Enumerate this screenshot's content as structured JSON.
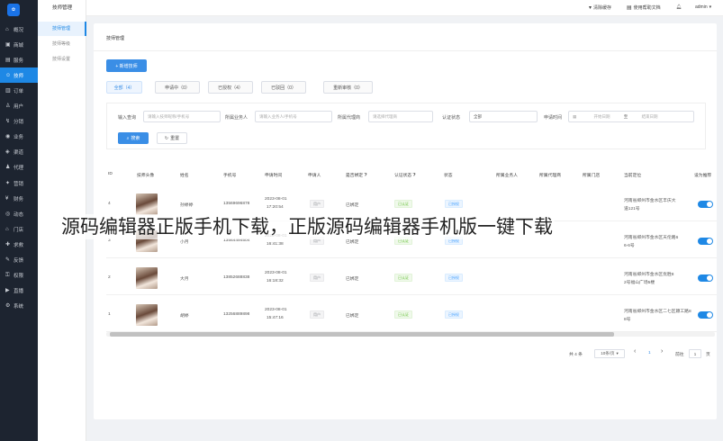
{
  "nav": {
    "logo": "logo",
    "items": [
      {
        "label": "概况",
        "icon": "home-icon"
      },
      {
        "label": "商城",
        "icon": "shop-icon"
      },
      {
        "label": "服务",
        "icon": "service-icon"
      },
      {
        "label": "技师",
        "icon": "technician-icon"
      },
      {
        "label": "订单",
        "icon": "order-icon"
      },
      {
        "label": "用户",
        "icon": "user-icon"
      },
      {
        "label": "分销",
        "icon": "distribution-icon"
      },
      {
        "label": "业务",
        "icon": "business-icon"
      },
      {
        "label": "渠道",
        "icon": "channel-icon"
      },
      {
        "label": "代理",
        "icon": "agent-icon"
      },
      {
        "label": "营销",
        "icon": "marketing-icon"
      },
      {
        "label": "财务",
        "icon": "finance-icon"
      },
      {
        "label": "动态",
        "icon": "feed-icon"
      },
      {
        "label": "门店",
        "icon": "store-icon"
      },
      {
        "label": "求救",
        "icon": "sos-icon"
      },
      {
        "label": "反馈",
        "icon": "feedback-icon"
      },
      {
        "label": "权限",
        "icon": "permission-icon"
      },
      {
        "label": "直播",
        "icon": "live-icon"
      },
      {
        "label": "系统",
        "icon": "system-icon"
      }
    ],
    "active_index": 3
  },
  "sub_nav": {
    "title": "技师管理",
    "items": [
      "技师管理",
      "技师等级",
      "技师设置"
    ]
  },
  "topbar": {
    "clear_cache": "清除缓存",
    "version": "使用帮助文档",
    "user": "admin"
  },
  "panel": {
    "breadcrumb": "技师管理",
    "add_button": "+ 新增技师",
    "tabs": [
      "全部（4）",
      "申请中（0）",
      "已授权（4）",
      "已驳回（0）",
      "重新审核（0）"
    ],
    "filter": {
      "keyword_label": "输入查询",
      "keyword_placeholder": "请输入技师昵称/手机号",
      "biz_label": "所属业务人",
      "biz_placeholder": "请输入业务人/手机号",
      "agent_label": "所属代理商",
      "agent_placeholder": "请选择代理商",
      "auth_label": "认证状态",
      "auth_value": "全部",
      "time_label": "申请时间",
      "time_start": "开始日期",
      "time_sep": "至",
      "time_end": "结束日期",
      "search_button": "搜索",
      "reset_button": "重置"
    },
    "table": {
      "headers": [
        "ID",
        "技师头像",
        "姓名",
        "手机号",
        "申请时间",
        "申请人",
        "是否绑定",
        "认证状态",
        "状态",
        "所属业务人",
        "所属代理商",
        "所属门店",
        "当前定位",
        "设为推荐"
      ],
      "rows": [
        {
          "id": "4",
          "name": "孙婷婷",
          "phone": "13569696878",
          "date": "2023-08-01",
          "time": "17:20:54",
          "applicant": "用户",
          "bind": "已绑定",
          "auth": "已认证",
          "status": "已授权",
          "location1": "河南省郑州市金水区丰庆大",
          "location2": "道121号"
        },
        {
          "id": "3",
          "name": "小月",
          "phone": "13564494504",
          "date": "2023-08-01",
          "time": "16:41:38",
          "applicant": "用户",
          "bind": "已绑定",
          "auth": "已认证",
          "status": "已授权",
          "location1": "河南省郑州市金水区天伦路6",
          "location2": "6-6号"
        },
        {
          "id": "2",
          "name": "大月",
          "phone": "13852688838",
          "date": "2023-08-01",
          "time": "16:18:32",
          "applicant": "用户",
          "bind": "已绑定",
          "auth": "已认证",
          "status": "已授权",
          "location1": "河南省郑州市金水区优胜8",
          "location2": "2号福山广场5楼"
        },
        {
          "id": "1",
          "name": "胡婷",
          "phone": "13256889898",
          "date": "2023-08-01",
          "time": "15:47:16",
          "applicant": "用户",
          "bind": "已绑定",
          "auth": "已认证",
          "status": "已授权",
          "location1": "河南省郑州市金水区二七区颖工路8",
          "location2": "8号"
        }
      ]
    },
    "pagination": {
      "total": "共 4 条",
      "page_size": "10条/页",
      "prev": "‹",
      "current": "1",
      "next": "›",
      "goto_label": "前往",
      "goto_value": "1",
      "goto_suffix": "页"
    }
  },
  "overlay_text": "源码编辑器正版手机下载，正版源码编辑器手机版一键下载",
  "colors": {
    "accent": "#1e88e5",
    "nav_bg": "#1d2430"
  }
}
